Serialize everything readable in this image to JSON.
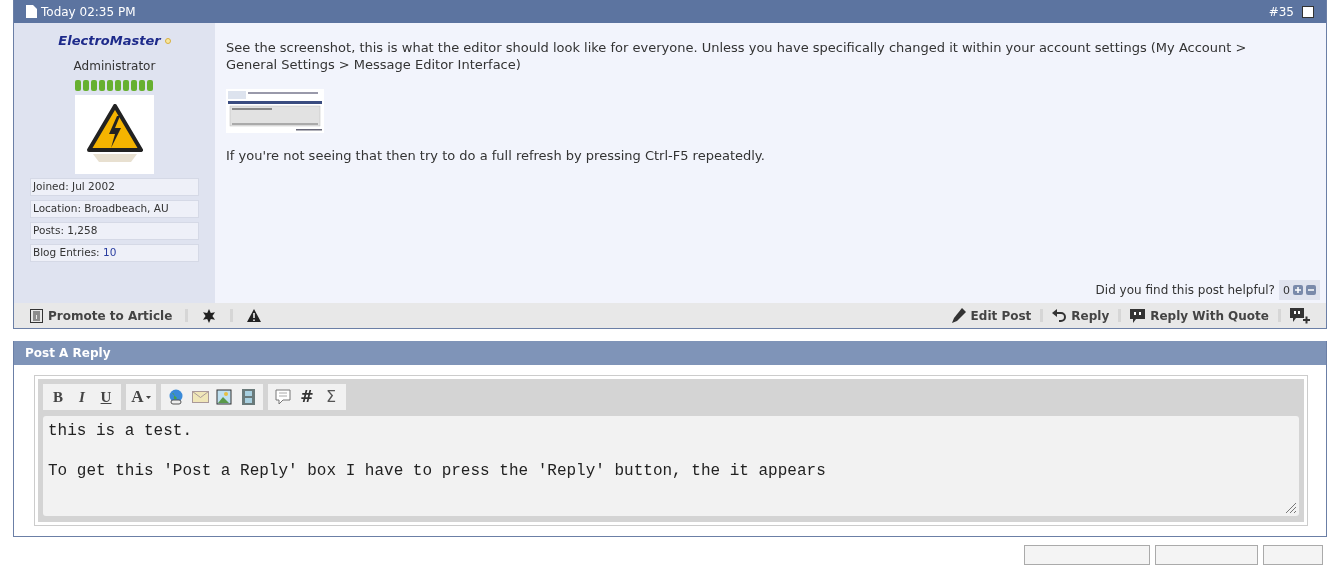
{
  "post": {
    "date": "Today 02:35 PM",
    "number": "#35",
    "checked": false,
    "author": {
      "name": "ElectroMaster",
      "online": false,
      "title": "Administrator",
      "stats": [
        {
          "label": "Joined:",
          "value": "Jul 2002",
          "kind": "text"
        },
        {
          "label": "Location:",
          "value": "Broadbeach, AU",
          "kind": "text"
        },
        {
          "label": "Posts:",
          "value": "1,258",
          "kind": "text"
        },
        {
          "label": "Blog Entries:",
          "value": "10",
          "kind": "link"
        }
      ]
    },
    "message": [
      "See the screenshot, this is what the editor should look like for everyone. Unless you have specifically changed it within your account settings (My Account > General Settings > Message Editor Interface)",
      "If you're not seeing that then try to do a full refresh by pressing Ctrl-F5 repeatedly."
    ],
    "helpful": {
      "question": "Did you find this post helpful?",
      "count": "0"
    },
    "left_actions": [
      {
        "kind": "promote",
        "label": "Promote to Article"
      },
      {
        "kind": "star"
      },
      {
        "kind": "warning"
      }
    ],
    "right_actions": [
      {
        "kind": "edit",
        "label": "Edit Post"
      },
      {
        "kind": "reply",
        "label": "Reply"
      },
      {
        "kind": "quote",
        "label": "Reply With Quote"
      },
      {
        "kind": "multiquote"
      }
    ]
  },
  "reply": {
    "title": "Post A Reply",
    "toolbar": [
      [
        {
          "kind": "bold",
          "label": "B"
        },
        {
          "kind": "italic",
          "label": "I"
        },
        {
          "kind": "underline",
          "label": "U"
        }
      ],
      [
        {
          "kind": "font",
          "label": "A"
        }
      ],
      [
        {
          "kind": "link"
        },
        {
          "kind": "email"
        },
        {
          "kind": "image"
        },
        {
          "kind": "video"
        }
      ],
      [
        {
          "kind": "quote"
        },
        {
          "kind": "hash",
          "label": "#"
        },
        {
          "kind": "sigma",
          "label": "Σ"
        }
      ]
    ],
    "value": "this is a test.\n\nTo get this 'Post a Reply' box I have to press the 'Reply' button, the it appears"
  }
}
